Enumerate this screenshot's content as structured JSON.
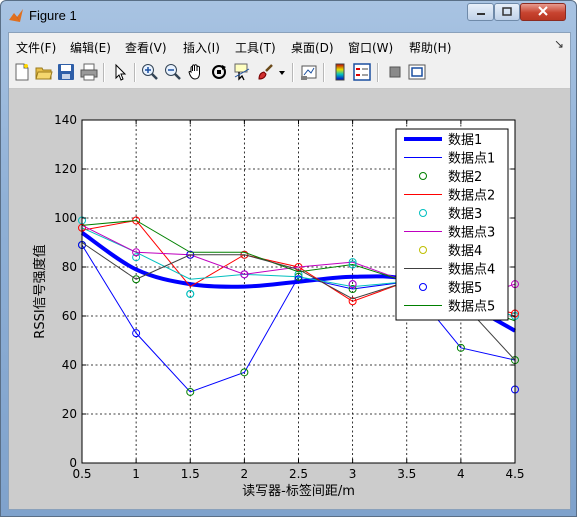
{
  "window": {
    "title": "Figure 1",
    "icons": {
      "app": "matlab-figure-icon",
      "minimize": "minimize-icon",
      "maximize": "maximize-icon",
      "close": "close-icon"
    }
  },
  "menu": {
    "items": [
      "文件(F)",
      "编辑(E)",
      "查看(V)",
      "插入(I)",
      "工具(T)",
      "桌面(D)",
      "窗口(W)",
      "帮助(H)"
    ],
    "overflow_glyph": "↘"
  },
  "toolbar": {
    "tools": [
      "new-figure-icon",
      "open-file-icon",
      "save-icon",
      "print-icon",
      "edit-plot-pointer-icon",
      "zoom-in-icon",
      "zoom-out-icon",
      "pan-hand-icon",
      "rotate-3d-icon",
      "data-cursor-icon",
      "brush-icon",
      "brush-dropdown-icon",
      "link-plot-icon",
      "insert-colorbar-icon",
      "insert-legend-icon",
      "hide-plot-tools-icon",
      "show-plot-tools-icon"
    ]
  },
  "chart_data": {
    "type": "line",
    "xlabel": "读写器-标签间距/m",
    "ylabel": "RSSI信号强度值",
    "xlim": [
      0.5,
      4.5
    ],
    "ylim": [
      0,
      140
    ],
    "xticks": [
      0.5,
      1,
      1.5,
      2,
      2.5,
      3,
      3.5,
      4,
      4.5
    ],
    "yticks": [
      0,
      20,
      40,
      60,
      80,
      100,
      120,
      140
    ],
    "grid": "on, dashed black",
    "legend_position": "top-right inside",
    "background": "#ffffff",
    "series": [
      {
        "name": "数据1",
        "kind": "line",
        "color": "#0000ff",
        "width": "thick",
        "x": [
          0.5,
          1,
          1.5,
          2,
          2.5,
          3,
          3.5,
          4,
          4.5
        ],
        "y": [
          94,
          79,
          73,
          72,
          74,
          76,
          75,
          66,
          54
        ]
      },
      {
        "name": "数据点1",
        "kind": "line",
        "color": "#0000ff",
        "width": "thin",
        "x": [
          0.5,
          1,
          1.5,
          2,
          2.5,
          3,
          3.5,
          4,
          4.5
        ],
        "y": [
          89,
          53,
          29,
          37,
          76,
          71,
          74,
          47,
          42
        ]
      },
      {
        "name": "数据2",
        "kind": "markers",
        "color": "#008000",
        "x": [
          0.5,
          1,
          1.5,
          2,
          2.5,
          3,
          3.5,
          4,
          4.5
        ],
        "y": [
          89,
          75,
          29,
          37,
          76,
          71,
          74,
          47,
          42
        ]
      },
      {
        "name": "数据点2",
        "kind": "line",
        "color": "#ff0000",
        "width": "thin",
        "x": [
          0.5,
          1,
          1.5,
          2,
          2.5,
          3,
          3.5,
          4,
          4.5
        ],
        "y": [
          95,
          99,
          72,
          85,
          80,
          66,
          74,
          66,
          61
        ]
      },
      {
        "name": "数据3",
        "kind": "markers",
        "color": "#00bfbf",
        "x": [
          0.5,
          1,
          1.5,
          2,
          2.5,
          3,
          3.5,
          4,
          4.5
        ],
        "y": [
          99,
          84,
          69,
          85,
          77,
          82,
          74,
          66,
          60
        ]
      },
      {
        "name": "数据点3",
        "kind": "line",
        "color": "#00bfbf",
        "width": "thin",
        "x": [
          0.5,
          1,
          1.5,
          2,
          2.5,
          3,
          3.5,
          4,
          4.5
        ],
        "y": [
          96,
          86,
          75,
          77,
          76,
          72,
          74,
          66,
          60
        ]
      },
      {
        "name": "数据4",
        "kind": "markers",
        "color": "#ff0000",
        "x": [
          0.5,
          1,
          1.5,
          2,
          2.5,
          3,
          3.5,
          4,
          4.5
        ],
        "y": [
          96,
          99,
          85,
          85,
          80,
          66,
          74,
          66,
          61
        ]
      },
      {
        "name": "数据点4",
        "kind": "line",
        "color": "#bf00bf",
        "width": "thin",
        "x": [
          0.5,
          1,
          1.5,
          2,
          2.5,
          3,
          3.5,
          4,
          4.5
        ],
        "y": [
          97,
          86,
          85,
          77,
          80,
          82,
          74,
          66,
          73
        ]
      },
      {
        "name": "数据5",
        "kind": "markers",
        "color": "#0000ff",
        "x": [
          0.5,
          1,
          1.5,
          2,
          2.5,
          3,
          3.5,
          4,
          4.5
        ],
        "y": [
          89,
          53,
          85,
          77,
          75,
          73,
          74,
          66,
          30
        ]
      },
      {
        "name": "数据点5",
        "kind": "line",
        "color": "#008000",
        "width": "thin",
        "x": [
          0.5,
          1,
          1.5,
          2,
          2.5,
          3,
          3.5,
          4,
          4.5
        ],
        "y": [
          97,
          99,
          86,
          86,
          78,
          81,
          74,
          66,
          58
        ]
      },
      {
        "name": "",
        "kind": "markers",
        "color": "#bf00bf",
        "x": [
          1,
          2,
          3,
          4.5
        ],
        "y": [
          86,
          77,
          73,
          73
        ]
      },
      {
        "name": "",
        "kind": "markers",
        "color": "#00bfbf",
        "x": [
          1.5,
          3
        ],
        "y": [
          69,
          81
        ]
      },
      {
        "name": "",
        "kind": "line",
        "color": "#404040",
        "width": "thin",
        "x": [
          0.5,
          1,
          1.5,
          2,
          2.5,
          3,
          3.5,
          4,
          4.5
        ],
        "y": [
          90,
          75,
          85,
          85,
          79,
          67,
          74,
          66,
          42
        ]
      }
    ],
    "legend": [
      {
        "label": "数据1",
        "style": "thick-line",
        "color": "#0000ff"
      },
      {
        "label": "数据点1",
        "style": "line",
        "color": "#0000ff"
      },
      {
        "label": "数据2",
        "style": "marker",
        "color": "#008000"
      },
      {
        "label": "数据点2",
        "style": "line",
        "color": "#ff0000"
      },
      {
        "label": "数据3",
        "style": "marker",
        "color": "#00bfbf"
      },
      {
        "label": "数据点3",
        "style": "line",
        "color": "#bf00bf"
      },
      {
        "label": "数据4",
        "style": "marker",
        "color": "#bfbf00"
      },
      {
        "label": "数据点4",
        "style": "line",
        "color": "#404040"
      },
      {
        "label": "数据5",
        "style": "marker",
        "color": "#0000ff"
      },
      {
        "label": "数据点5",
        "style": "line",
        "color": "#008000"
      }
    ]
  }
}
